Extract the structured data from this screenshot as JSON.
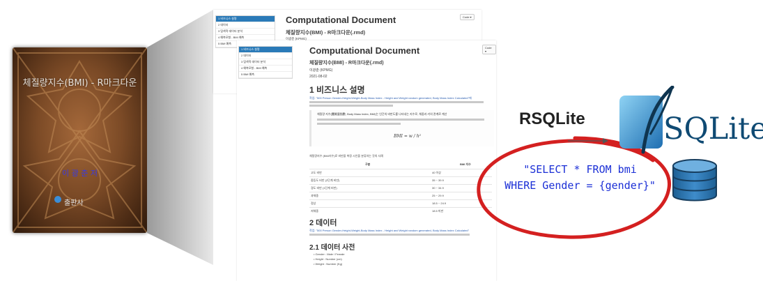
{
  "book": {
    "title": "체질량지수(BMI) - R마크다운",
    "author": "이 광 춘 저",
    "publisher": "출판사"
  },
  "doc_back": {
    "title": "Computational Document",
    "subtitle": "체질량지수(BMI) - R마크다운(.rmd)",
    "author": "이광춘 (KPMG)",
    "code_button": "Code ▾",
    "toc": [
      "1 비즈니스 설명",
      "2 데이터",
      "3 탐색적 데이터 분석",
      "4 예측모형 - BMI 예측",
      "5 BMI 예측"
    ]
  },
  "doc_front": {
    "title": "Computational Document",
    "subtitle": "체질량지수(BMI) - R마크다운(.rmd)",
    "author": "이광춘 (KPMG)",
    "date": "2021-08-02",
    "code_button": "Code ▾",
    "toc": [
      "1 비즈니스 설명",
      "2 데이터",
      "3 탐색적 데이터 분석",
      "4 예측모형 - BMI 예측",
      "5 BMI 예측"
    ],
    "section1": "1 비즈니스 설명",
    "section2": "2 데이터",
    "section2_1": "2.1 데이터 사전",
    "intro_link": "작업: \"500 Person Gender-Height-Weight-Body Mass Index - Height and Weight random generated, Body Mass Index Calculated\"에",
    "quote_text": "체질량 지수(體質量指數, Body Mass Index, BMI)는 인간의 비만도를 나타내는 지수로, 체중과 키의 관계로 계산",
    "formula": "BMI = w / h²",
    "table_caption": "체질량지수 (BMI지수)로 비만을 측정 시인을 분류하는 것의 사례",
    "table_header": [
      "구분",
      "BMI 지수"
    ],
    "table_rows": [
      [
        "고도 비만",
        "40 이상"
      ],
      [
        "중등도 비만 (2단계 비만)",
        "35 ~ 39.9"
      ],
      [
        "경도 비만 (1단계 비만)",
        "30 ~ 34.9"
      ],
      [
        "과체중",
        "25 ~ 29.9"
      ],
      [
        "정상",
        "18.5 ~ 24.9"
      ],
      [
        "저체중",
        "18.5 미만"
      ]
    ],
    "data_link": "작업: \"500 Person Gender-Height-Weight-Body Mass Index - Height and Weight random generated, Body Mass Index Calculated\"",
    "bullets": [
      "Gender : Male / Female",
      "Height : Number (cm)",
      "Weight : Number (Kg)"
    ]
  },
  "connector": {
    "label": "RSQLite",
    "sql_line1": "\"SELECT * FROM bmi",
    "sql_line2": "WHERE Gender = {gender}\""
  },
  "sqlite": {
    "wordmark": "SQLite"
  },
  "colors": {
    "ellipse_red": "#d42020",
    "sql_blue": "#1b2fd6",
    "sqlite_blue": "#0f4a73",
    "toc_active": "#2a7ab8"
  }
}
